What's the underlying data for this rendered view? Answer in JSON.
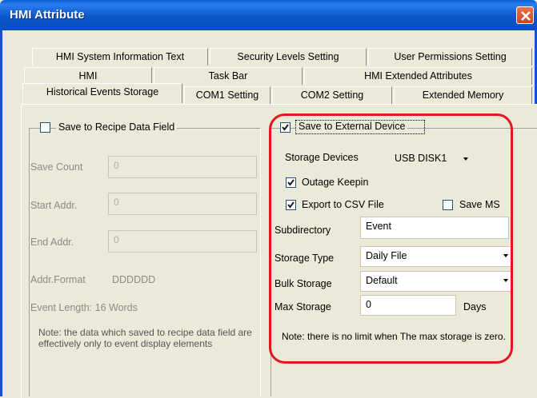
{
  "window": {
    "title": "HMI Attribute"
  },
  "tabs": {
    "row1": [
      "HMI System Information Text",
      "Security Levels Setting",
      "User Permissions Setting"
    ],
    "row2": [
      "HMI",
      "Task Bar",
      "HMI Extended Attributes"
    ],
    "row3": [
      "Historical Events Storage",
      "COM1 Setting",
      "COM2 Setting",
      "Extended Memory"
    ],
    "active": "Historical Events Storage"
  },
  "left": {
    "group_label": "Save to Recipe Data Field",
    "group_checked": false,
    "save_count_label": "Save Count",
    "save_count_value": "0",
    "start_addr_label": "Start Addr.",
    "start_addr_value": "0",
    "end_addr_label": "End Addr.",
    "end_addr_value": "0",
    "addr_format_label": "Addr.Format",
    "addr_format_value": "DDDDDD",
    "event_length": "Event Length: 16 Words",
    "note": "Note: the data which saved to recipe data field are effectively only to event display elements"
  },
  "right": {
    "group_label": "Save to External Device",
    "group_checked": true,
    "storage_devices_label": "Storage Devices",
    "storage_devices_value": "USB DISK1",
    "outage_keepin_label": "Outage Keepin",
    "outage_keepin_checked": true,
    "export_csv_label": "Export to CSV File",
    "export_csv_checked": true,
    "save_ms_label": "Save MS",
    "save_ms_checked": false,
    "subdirectory_label": "Subdirectory",
    "subdirectory_value": "Event",
    "storage_type_label": "Storage Type",
    "storage_type_value": "Daily File",
    "bulk_storage_label": "Bulk Storage",
    "bulk_storage_value": "Default",
    "max_storage_label": "Max Storage",
    "max_storage_value": "0",
    "max_storage_unit": "Days",
    "note": "Note: there is no limit when The max storage is zero."
  },
  "colors": {
    "highlight_annotation": "#e0181f",
    "titlebar": "#0b56c9"
  },
  "icons": {
    "close": "close-icon",
    "check": "check-icon",
    "dropdown": "chevron-down-icon"
  }
}
